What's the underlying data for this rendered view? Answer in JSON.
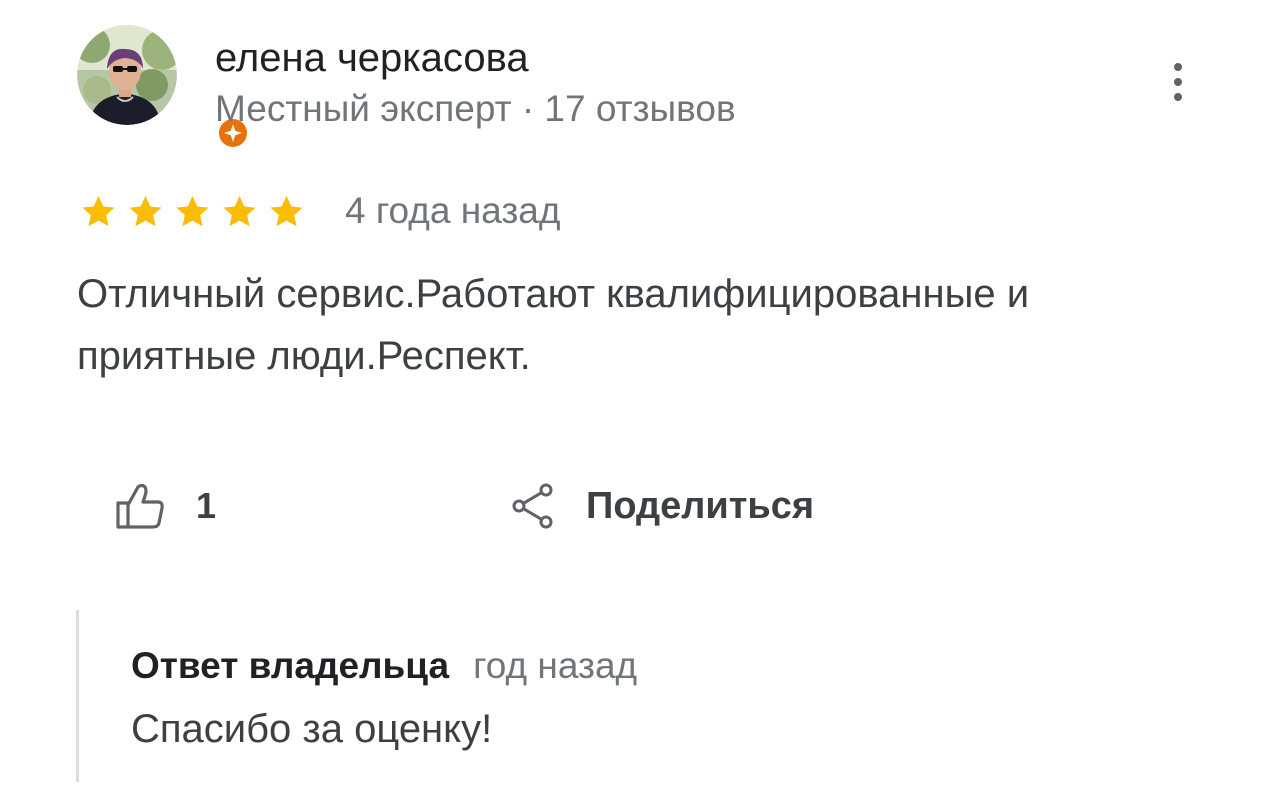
{
  "review": {
    "author": {
      "name": "елена черкасова",
      "meta": "Местный эксперт · 17 отзывов",
      "avatar_icon": "user-photo",
      "badge_icon": "local-guide-badge-icon"
    },
    "rating": 5,
    "rating_max": 5,
    "time": "4 года назад",
    "text": "Отличный сервис.Работают квалифицированные и приятные люди.Респект.",
    "actions": {
      "like_icon": "thumbs-up-icon",
      "like_count": "1",
      "share_icon": "share-icon",
      "share_label": "Поделиться",
      "more_icon": "more-vertical-icon"
    },
    "owner_reply": {
      "label": "Ответ владельца",
      "time": "год назад",
      "text": "Спасибо за оценку!"
    }
  },
  "colors": {
    "star": "#fbbc04",
    "badge": "#e8710a",
    "primary_text": "#202124",
    "secondary_text": "#70757a",
    "body_text": "#3c4043",
    "icon": "#5f6368",
    "divider": "#dadce0"
  }
}
